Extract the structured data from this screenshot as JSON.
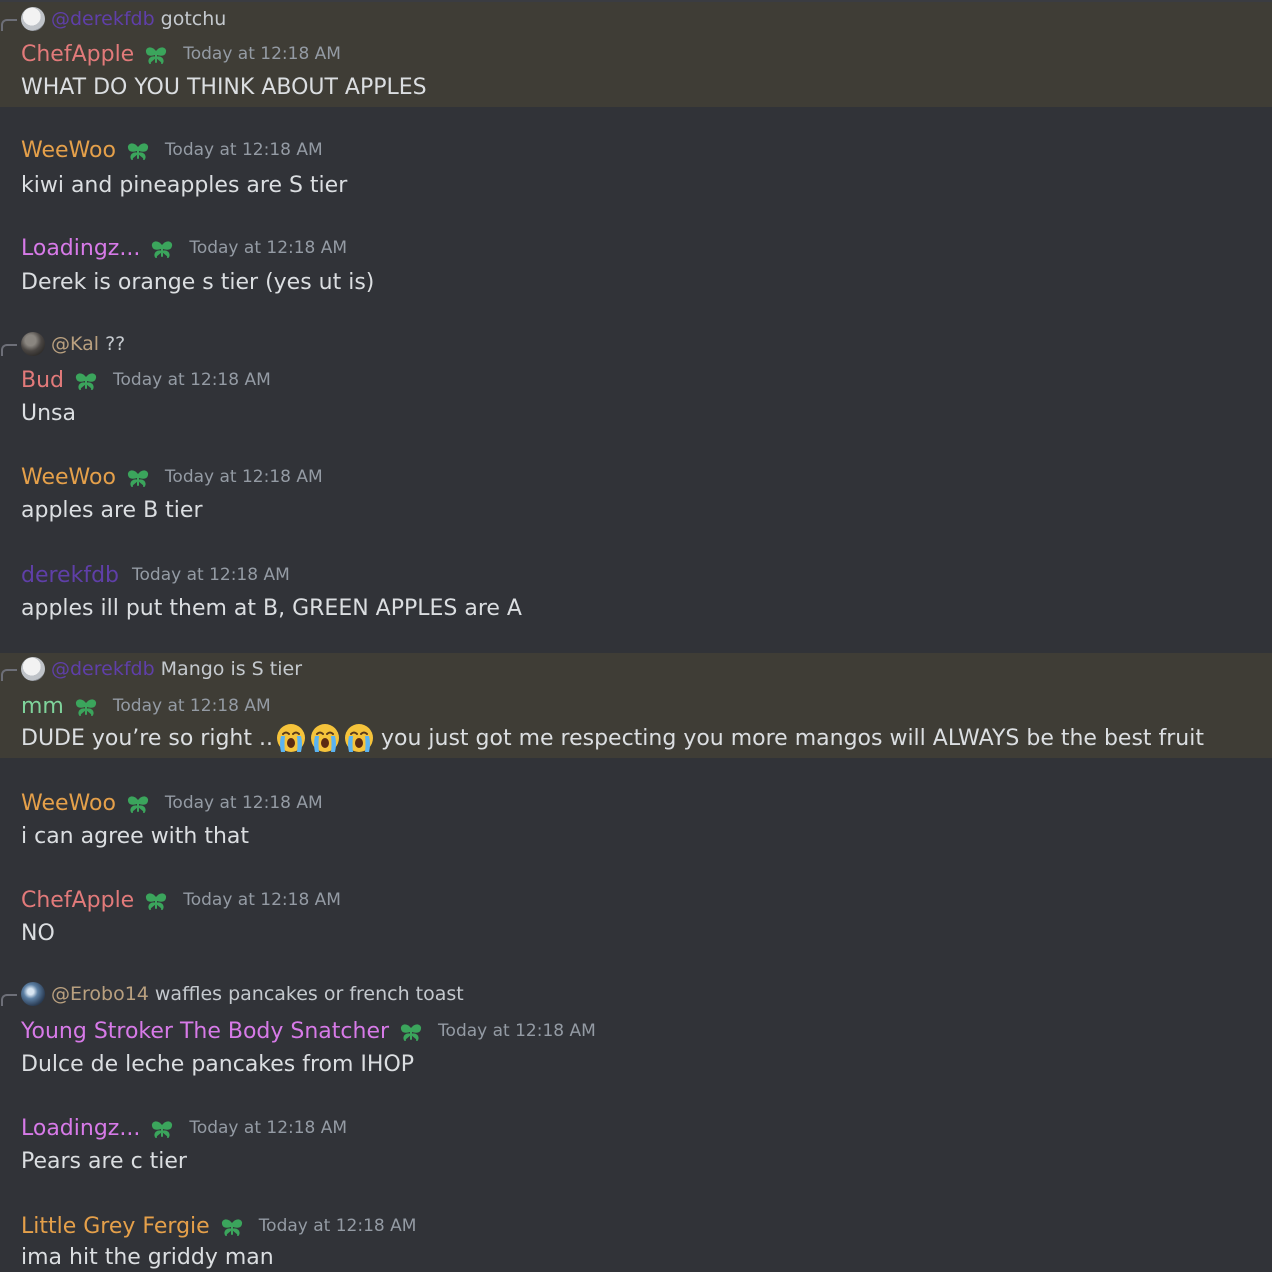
{
  "colors": {
    "background": "#313338",
    "highlight": "#3f3d36",
    "timestamp": "#949ba4",
    "badge": "#3ba55c"
  },
  "messages": [
    {
      "reply": {
        "author": "@derekfdb",
        "text": "gotchu",
        "author_color": "#5f3fa8",
        "avatar": "white-cat-avatar"
      },
      "author": "ChefApple",
      "author_color": "#e27a7a",
      "badge": true,
      "timestamp": "Today at 12:18 AM",
      "text": "WHAT DO YOU THINK ABOUT APPLES",
      "highlight": true
    },
    {
      "author": "WeeWoo",
      "author_color": "#e5a04a",
      "badge": true,
      "timestamp": "Today at 12:18 AM",
      "text": "kiwi and pineapples are S tier"
    },
    {
      "author": "Loadingz...",
      "author_color": "#d77ae8",
      "badge": true,
      "timestamp": "Today at 12:18 AM",
      "text": "Derek is orange s tier (yes ut is)"
    },
    {
      "reply": {
        "author": "@Kal",
        "text": "??",
        "author_color": "#b9a07f",
        "avatar": "dark-photo-avatar"
      },
      "author": "Bud",
      "author_color": "#e27a7a",
      "badge": true,
      "timestamp": "Today at 12:18 AM",
      "text": "Unsa"
    },
    {
      "author": "WeeWoo",
      "author_color": "#e5a04a",
      "badge": true,
      "timestamp": "Today at 12:18 AM",
      "text": "apples are B tier"
    },
    {
      "author": "derekfdb",
      "author_color": "#5f3fa8",
      "badge": false,
      "timestamp": "Today at 12:18 AM",
      "text": "apples ill put them at B, GREEN APPLES are A"
    },
    {
      "reply": {
        "author": "@derekfdb",
        "text": "Mango is S tier",
        "author_color": "#5f3fa8",
        "avatar": "white-cat-avatar"
      },
      "author": "mm",
      "author_color": "#7fd39b",
      "badge": true,
      "timestamp": "Today at 12:18 AM",
      "text_before": "DUDE you’re so right ..",
      "emojis": [
        "loudly-crying-face",
        "loudly-crying-face",
        "loudly-crying-face"
      ],
      "text_after": "you just got me respecting you more mangos will ALWAYS be the best fruit",
      "highlight": true
    },
    {
      "author": "WeeWoo",
      "author_color": "#e5a04a",
      "badge": true,
      "timestamp": "Today at 12:18 AM",
      "text": "i can agree with that"
    },
    {
      "author": "ChefApple",
      "author_color": "#e27a7a",
      "badge": true,
      "timestamp": "Today at 12:18 AM",
      "text": "NO"
    },
    {
      "reply": {
        "author": "@Erobo14",
        "text": "waffles pancakes or french toast",
        "author_color": "#b9a07f",
        "avatar": "blue-planet-avatar"
      },
      "author": "Young Stroker The Body Snatcher",
      "author_color": "#d77ae8",
      "badge": true,
      "timestamp": "Today at 12:18 AM",
      "text": "Dulce de leche pancakes from IHOP"
    },
    {
      "author": "Loadingz...",
      "author_color": "#d77ae8",
      "badge": true,
      "timestamp": "Today at 12:18 AM",
      "text": "Pears are c tier"
    },
    {
      "author": "Little Grey Fergie",
      "author_color": "#e5a04a",
      "badge": true,
      "timestamp": "Today at 12:18 AM",
      "text": "ima hit the griddy man"
    }
  ]
}
